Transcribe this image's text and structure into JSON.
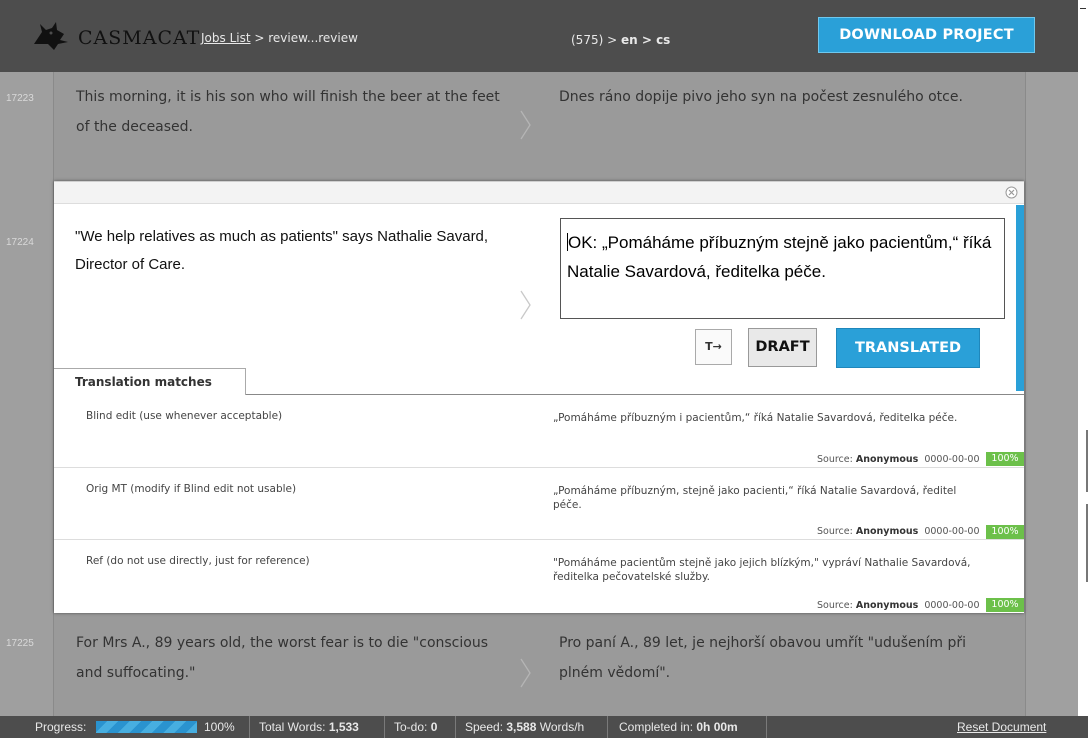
{
  "header": {
    "logo_text": "CASMACAT",
    "breadcrumb_link": "Jobs List",
    "breadcrumb_rest": " > review...review",
    "job_id": "(575) > ",
    "source_lang": "en",
    "lang_sep": " > ",
    "target_lang": "cs",
    "download_label": "DOWNLOAD PROJECT"
  },
  "segments": [
    {
      "id": "17223",
      "source": "This morning, it is his son who will finish the beer at the feet of the deceased.",
      "target": "Dnes ráno dopije pivo jeho syn na počest zesnulého otce."
    },
    {
      "id": "17225",
      "source": "For Mrs A., 89 years old, the worst fear is to die \"conscious and suffocating.\"",
      "target": "Pro paní A., 89 let, je nejhorší obavou umřít \"udušením při plném vědomí\"."
    }
  ],
  "active_segment": {
    "id": "17224",
    "source": "\"We help relatives as much as patients\" says Nathalie Savard, Director of Care.",
    "editor_text": "OK: „Pomáháme příbuzným stejně jako pacientům,“ říká Natalie Savardová, ředitelka péče.",
    "tag_button": "T→",
    "draft_label": "DRAFT",
    "translated_label": "TRANSLATED"
  },
  "matches": {
    "tab_label": "Translation matches",
    "items": [
      {
        "label": "Blind edit (use whenever acceptable)",
        "text": "„Pomáháme příbuzným i pacientům,“ říká Natalie Savardová, ředitelka péče.",
        "source_prefix": "Source: ",
        "source_name": "Anonymous",
        "date": "0000-00-00",
        "percent": "100%"
      },
      {
        "label": "Orig MT (modify if Blind edit not usable)",
        "text": "„Pomáháme příbuzným, stejně jako pacienti,“ říká Natalie Savardová, ředitel péče.",
        "source_prefix": "Source: ",
        "source_name": "Anonymous",
        "date": "0000-00-00",
        "percent": "100%"
      },
      {
        "label": "Ref (do not use directly, just for reference)",
        "text": "\"Pomáháme pacientům stejně jako jejich blízkým,\" vypráví Nathalie Savardová, ředitelka pečovatelské služby.",
        "source_prefix": "Source: ",
        "source_name": "Anonymous",
        "date": "0000-00-00",
        "percent": "100%"
      }
    ]
  },
  "footer": {
    "progress_label": "Progress:",
    "progress_value": 1.0,
    "progress_pct": "100%",
    "total_words_label": "Total Words: ",
    "total_words": "1,533",
    "todo_label": "To-do: ",
    "todo": "0",
    "speed_label": "Speed: ",
    "speed": "3,588",
    "speed_unit": " Words/h",
    "completed_label": "Completed in: ",
    "completed": "0h 00m",
    "reset_label": "Reset Document"
  },
  "colors": {
    "accent": "#2aa0d8",
    "match_green": "#6cc04a",
    "header_bg": "#4d4d4d"
  }
}
